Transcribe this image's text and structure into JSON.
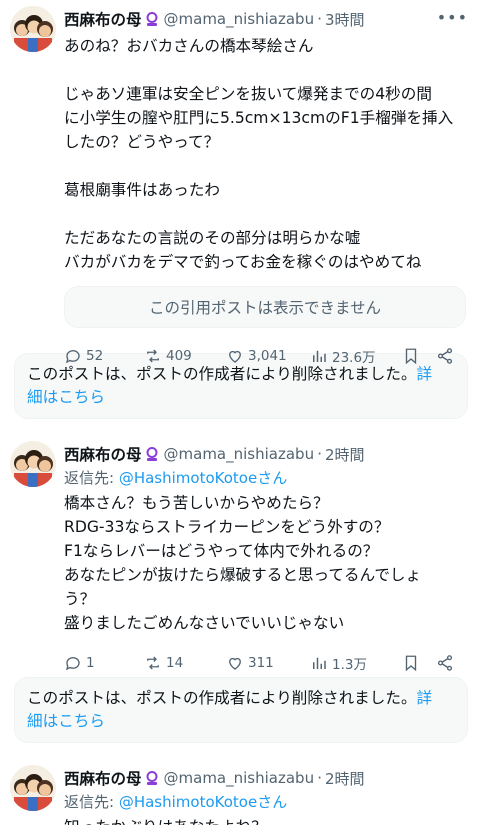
{
  "author": {
    "name": "西麻布の母",
    "handle": "@mama_nishiazabu",
    "badge_icon": "purple-ring-badge-icon"
  },
  "posts": [
    {
      "time": "3時間",
      "lines": [
        "あのね？おバカさんの橋本琴絵さん",
        "",
        "じゃあソ連軍は安全ピンを抜いて爆発までの4秒の間",
        "に小学生の膣や肛門に5.5cm×13cmのF1手榴弾を挿入",
        "したの？どうやって？",
        "",
        "葛根廟事件はあったわ",
        "",
        "ただあなたの言説のその部分は明らかな嘘",
        "バカがバカをデマで釣ってお金を稼ぐのはやめてね"
      ],
      "quote_unavailable": "この引用ポストは表示できません",
      "stats": {
        "replies": "52",
        "reposts": "409",
        "likes": "3,041",
        "views": "23.6万"
      }
    },
    {
      "time": "2時間",
      "reply_prefix": "返信先: ",
      "reply_mention": "@HashimotoKotoeさん",
      "lines": [
        "橋本さん？もう苦しいからやめたら？",
        "RDG-33ならストライカーピンをどう外すの？",
        "F1ならレバーはどうやって体内で外れるの？",
        "あなたピンが抜けたら爆破すると思ってるんでしょ",
        "う？",
        "盛りましたごめんなさいでいいじゃない"
      ],
      "stats": {
        "replies": "1",
        "reposts": "14",
        "likes": "311",
        "views": "1.3万"
      }
    },
    {
      "time": "2時間",
      "reply_prefix": "返信先: ",
      "reply_mention": "@HashimotoKotoeさん",
      "lines": [
        "知ったかぶりはあなたよね？"
      ]
    }
  ],
  "deleted_notice": {
    "text": "このポストは、ポストの作成者により削除されました。",
    "link_part1": "詳",
    "link_part2": "細はこちら"
  },
  "colors": {
    "accent": "#1d9bf0",
    "muted": "#536471",
    "text": "#0f1419",
    "badge": "#8b3fd9"
  }
}
